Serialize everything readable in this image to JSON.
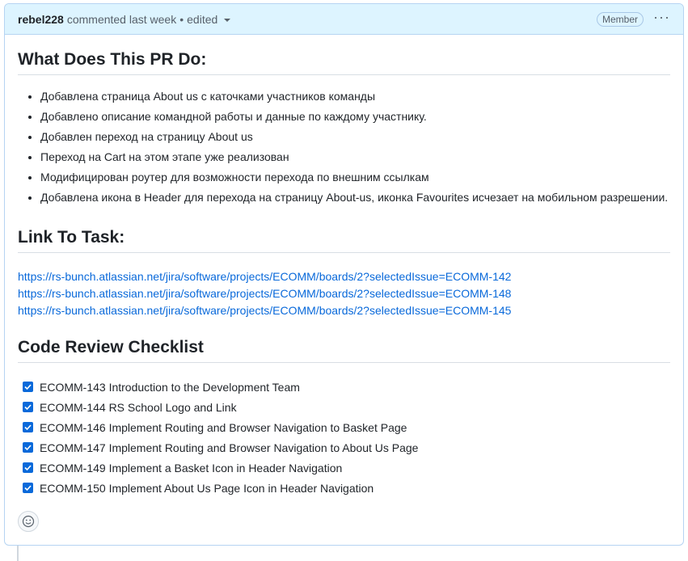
{
  "header": {
    "author": "rebel228",
    "action": "commented last week",
    "separator": "•",
    "edited": "edited",
    "badge": "Member",
    "more_icon": "kebab-horizontal-icon"
  },
  "sections": {
    "what_title": "What Does This PR Do:",
    "bullets": [
      "Добавлена страница About us с каточками участников команды",
      "Добавлено описание командной работы и данные по каждому участнику.",
      "Добавлен переход на страницу About us",
      "Переход на Cart на этом этапе уже реализован",
      "Модифицирован роутер для возможности перехода по внешним ссылкам",
      "Добавлена икона в Header для перехода на страницу About-us, иконка Favourites исчезает на мобильном разрешении."
    ],
    "link_title": "Link To Task:",
    "links": [
      "https://rs-bunch.atlassian.net/jira/software/projects/ECOMM/boards/2?selectedIssue=ECOMM-142",
      "https://rs-bunch.atlassian.net/jira/software/projects/ECOMM/boards/2?selectedIssue=ECOMM-148",
      "https://rs-bunch.atlassian.net/jira/software/projects/ECOMM/boards/2?selectedIssue=ECOMM-145"
    ],
    "checklist_title": "Code Review Checklist",
    "tasks": [
      "ECOMM-143 Introduction to the Development Team",
      "ECOMM-144 RS School Logo and Link",
      "ECOMM-146 Implement Routing and Browser Navigation to Basket Page",
      "ECOMM-147 Implement Routing and Browser Navigation to About Us Page",
      "ECOMM-149 Implement a Basket Icon in Header Navigation",
      "ECOMM-150 Implement About Us Page Icon in Header Navigation"
    ]
  },
  "colors": {
    "header_bg": "#ddf4ff",
    "link": "#0969da",
    "checkbox": "#0969da"
  }
}
